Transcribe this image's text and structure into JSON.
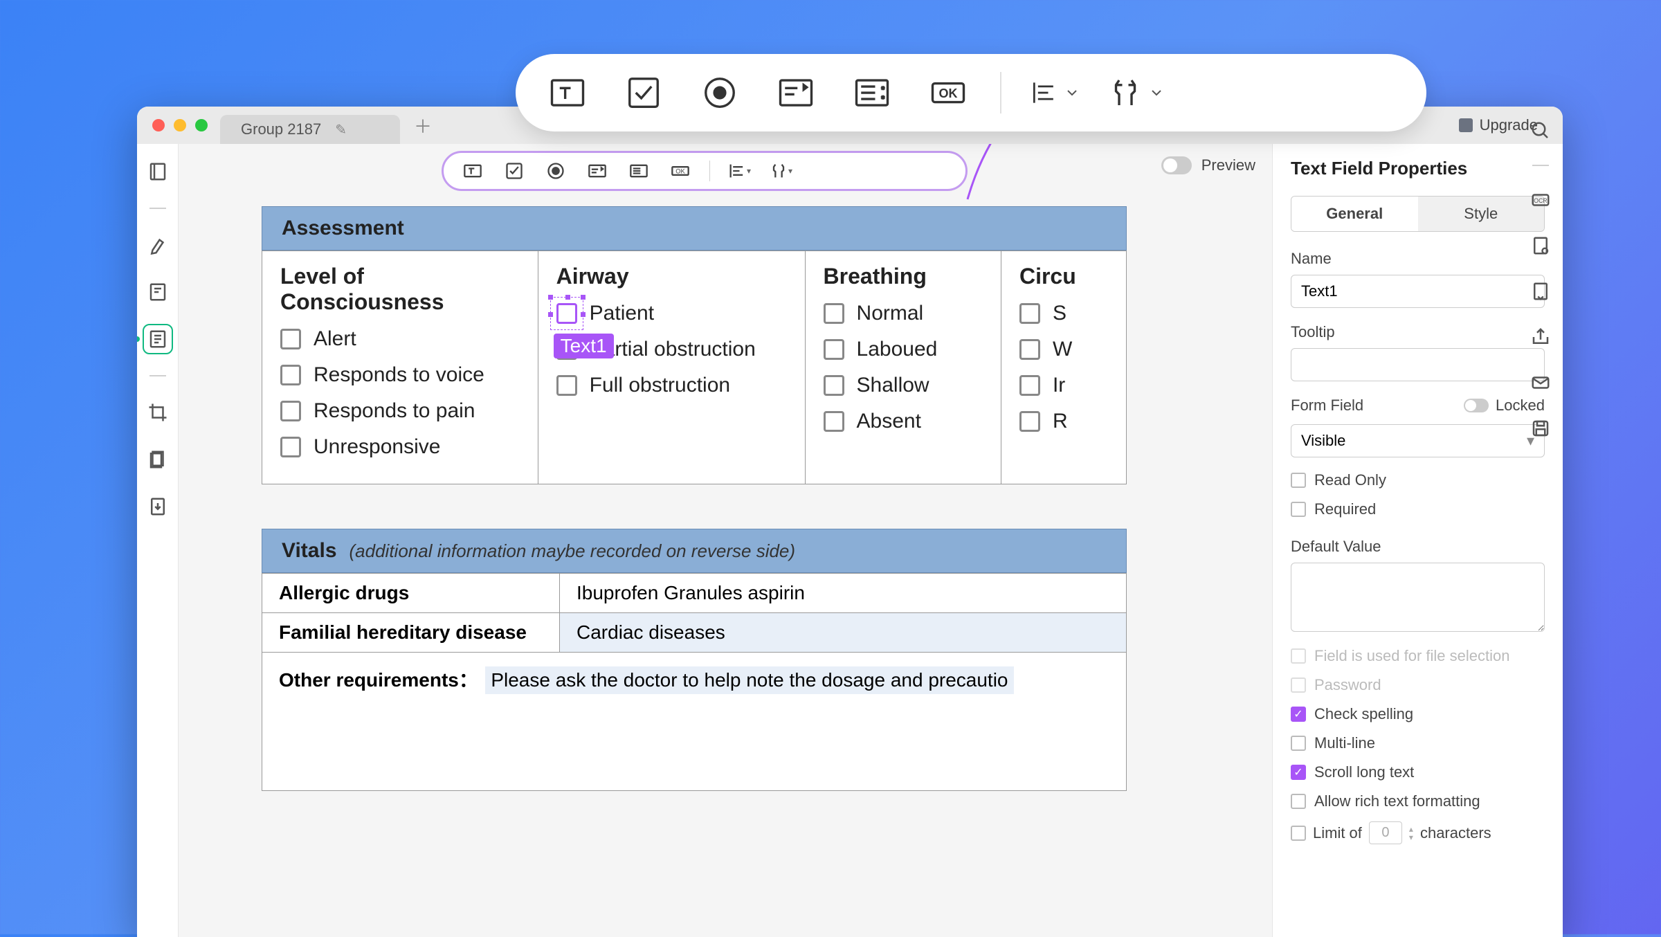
{
  "window": {
    "tab_title": "Group 2187",
    "upgrade_label": "Upgrade"
  },
  "inner_toolbar": {
    "preview_label": "Preview"
  },
  "doc": {
    "assessment": {
      "header": "Assessment",
      "cols": [
        {
          "title": "Level of Consciousness",
          "items": [
            "Alert",
            "Responds to voice",
            "Responds to pain",
            "Unresponsive"
          ]
        },
        {
          "title": "Airway",
          "items": [
            "Patient",
            "Partial obstruction",
            "Full obstruction"
          ],
          "selected_badge": "Text1"
        },
        {
          "title": "Breathing",
          "items": [
            "Normal",
            "Laboued",
            "Shallow",
            "Absent"
          ]
        },
        {
          "title": "Circu",
          "items": [
            "S",
            "W",
            "Ir",
            "R"
          ]
        }
      ]
    },
    "vitals": {
      "header": "Vitals",
      "subheader": "(additional information maybe recorded on reverse side)",
      "rows": [
        {
          "label": "Allergic drugs",
          "value": "Ibuprofen Granules  aspirin"
        },
        {
          "label": "Familial hereditary disease",
          "value": "Cardiac diseases"
        }
      ],
      "other_req_label": "Other requirements：",
      "other_req_value": "Please ask the doctor to help note the dosage and precautio"
    }
  },
  "props": {
    "title": "Text Field Properties",
    "tabs": [
      "General",
      "Style"
    ],
    "name_label": "Name",
    "name_value": "Text1",
    "tooltip_label": "Tooltip",
    "tooltip_value": "",
    "formfield_label": "Form Field",
    "locked_label": "Locked",
    "visibility_value": "Visible",
    "readonly_label": "Read Only",
    "required_label": "Required",
    "default_value_label": "Default Value",
    "file_selection_label": "Field is used for file selection",
    "password_label": "Password",
    "check_spelling_label": "Check spelling",
    "multiline_label": "Multi-line",
    "scroll_long_text_label": "Scroll long text",
    "rich_text_label": "Allow rich text formatting",
    "limit_prefix": "Limit of",
    "limit_value": "0",
    "limit_suffix": "characters"
  }
}
